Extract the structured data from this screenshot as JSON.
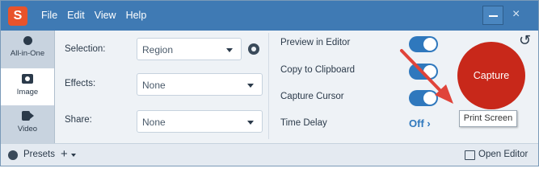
{
  "app": {
    "logo_letter": "S",
    "accent_color": "#3f7ab4",
    "capture_color": "#c8281a"
  },
  "menu": {
    "items": [
      {
        "label": "File"
      },
      {
        "label": "Edit"
      },
      {
        "label": "View"
      },
      {
        "label": "Help"
      }
    ]
  },
  "window_controls": {
    "close_glyph": "×"
  },
  "modes": [
    {
      "label": "All-in-One",
      "icon": "circle-icon"
    },
    {
      "label": "Image",
      "icon": "camera-icon",
      "active": true
    },
    {
      "label": "Video",
      "icon": "video-icon"
    }
  ],
  "settings": {
    "selection": {
      "label": "Selection:",
      "value": "Region"
    },
    "effects": {
      "label": "Effects:",
      "value": "None"
    },
    "share": {
      "label": "Share:",
      "value": "None"
    }
  },
  "options": {
    "preview_in_editor": {
      "label": "Preview in Editor",
      "on": true
    },
    "copy_to_clipboard": {
      "label": "Copy to Clipboard",
      "on": true
    },
    "capture_cursor": {
      "label": "Capture Cursor",
      "on": true
    },
    "time_delay": {
      "label": "Time Delay",
      "value": "Off ›"
    }
  },
  "capture": {
    "label": "Capture",
    "reset_glyph": "↺"
  },
  "tooltip": {
    "text": "Print Screen"
  },
  "bottom": {
    "presets_label": "Presets",
    "add_glyph": "+",
    "open_editor_label": "Open Editor"
  }
}
